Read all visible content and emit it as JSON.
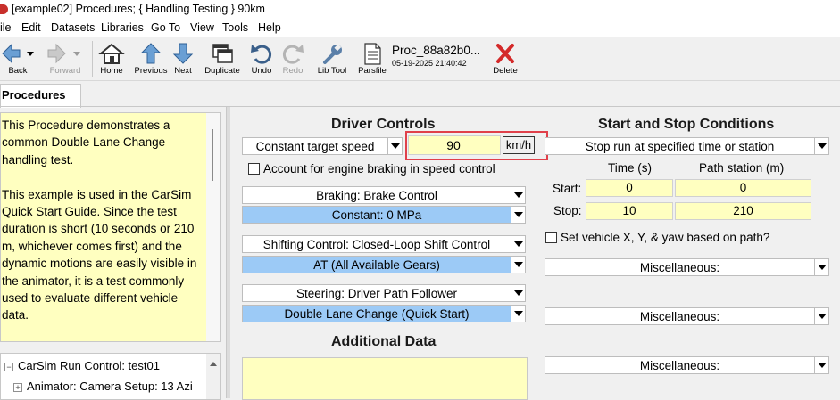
{
  "window": {
    "title": "[example02] Procedures; { Handling Testing } 90km"
  },
  "menu": [
    "ile",
    "Edit",
    "Datasets",
    "Libraries",
    "Go To",
    "View",
    "Tools",
    "Help"
  ],
  "toolbar": {
    "back": "Back",
    "forward": "Forward",
    "home": "Home",
    "previous": "Previous",
    "next": "Next",
    "duplicate": "Duplicate",
    "undo": "Undo",
    "redo": "Redo",
    "lib_tool": "Lib Tool",
    "parsfile": "Parsfile",
    "delete": "Delete",
    "parsfile_name": "Proc_88a82b0...",
    "parsfile_date": "05-19-2025 21:40:42"
  },
  "tabs": {
    "active": "Procedures"
  },
  "notes": {
    "text": "This Procedure demonstrates a common Double Lane Change handling test.\n\nThis example is used in the CarSim Quick Start Guide. Since the test duration is short (10 seconds or 210 m, whichever comes first) and the dynamic motions are easily visible in the animator, it is a test commonly used to evaluate different vehicle data."
  },
  "tree": {
    "items": [
      "CarSim Run Control: test01",
      "Animator: Camera Setup: 13 Azi"
    ]
  },
  "driver_controls": {
    "heading": "Driver Controls",
    "speed_mode": "Constant target speed",
    "speed_value": "90",
    "speed_unit": "km/h",
    "engine_braking_label": "Account for engine braking in speed control",
    "braking_label": "Braking: Brake Control",
    "braking_value": "Constant: 0 MPa",
    "shifting_label": "Shifting Control: Closed-Loop Shift Control",
    "shifting_value": "AT (All Available Gears)",
    "steering_label": "Steering: Driver Path Follower",
    "steering_value": "Double Lane Change (Quick Start)"
  },
  "additional_data": {
    "heading": "Additional Data"
  },
  "start_stop": {
    "heading": "Start and Stop Conditions",
    "mode": "Stop run at specified time or station",
    "time_header": "Time (s)",
    "station_header": "Path station (m)",
    "start_label": "Start:",
    "stop_label": "Stop:",
    "start_time": "0",
    "start_station": "0",
    "stop_time": "10",
    "stop_station": "210",
    "set_xy_label": "Set vehicle X, Y, & yaw based on path?",
    "misc1": "Miscellaneous:",
    "misc2": "Miscellaneous:",
    "misc3": "Miscellaneous:"
  }
}
